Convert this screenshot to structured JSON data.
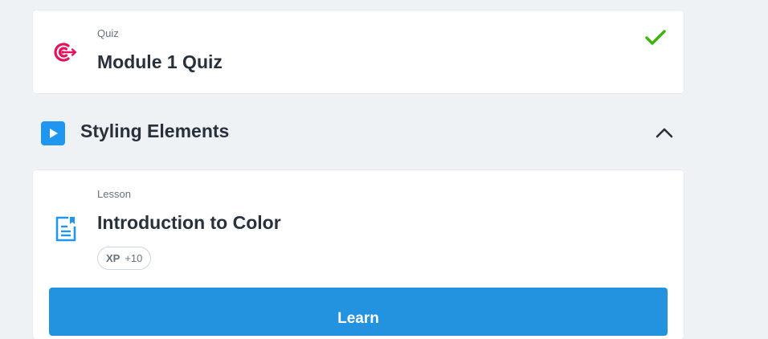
{
  "quiz_card": {
    "type_label": "Quiz",
    "title": "Module 1 Quiz",
    "icon": "target-icon",
    "status_icon": "check-icon",
    "status_color": "#3cb30b",
    "icon_color": "#e5135e"
  },
  "section": {
    "title": "Styling Elements",
    "icon": "play-icon",
    "toggle_icon": "chevron-up-icon",
    "icon_color": "#1f96f0"
  },
  "lesson_card": {
    "type_label": "Lesson",
    "title": "Introduction to Color",
    "icon": "document-icon",
    "icon_color": "#1f96f0",
    "xp": {
      "label": "XP",
      "value": "+10"
    },
    "button_label": "Learn",
    "button_color": "#2393e0"
  }
}
